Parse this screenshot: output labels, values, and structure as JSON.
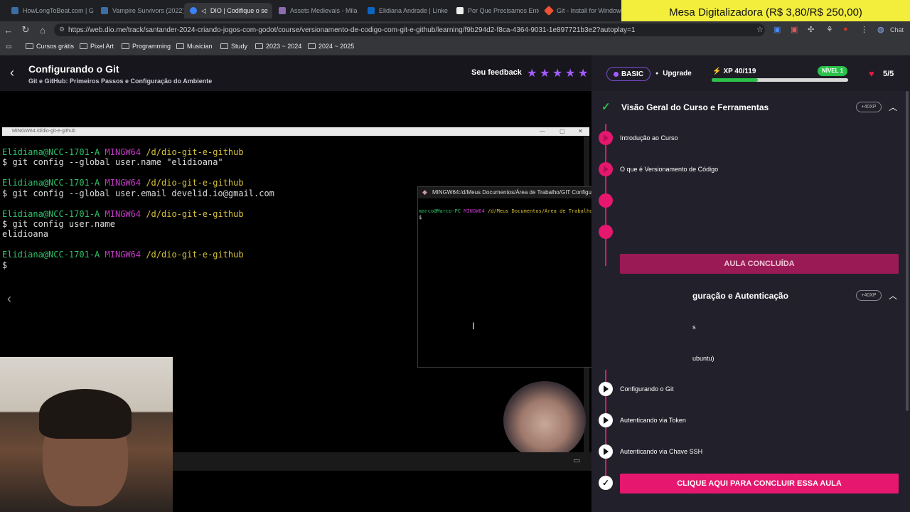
{
  "browser": {
    "tabs": [
      {
        "title": "HowLongToBeat.com | G",
        "favicon_color": "#3a6ea5"
      },
      {
        "title": "Vampire Survivors (2022)",
        "favicon_color": "#3a6ea5"
      },
      {
        "title": "DIO | Codifique o se",
        "favicon_color": "#3b82f6"
      },
      {
        "title": "Assets Medievais - Mila",
        "favicon_color": "#8c6bb1"
      },
      {
        "title": "Elidiana Andrade | Linke",
        "favicon_color": "#0a66c2"
      },
      {
        "title": "Por Que Precisamos Ente",
        "favicon_color": "#eeeeee"
      },
      {
        "title": "Git - Install for Windows",
        "favicon_color": "#f05133"
      }
    ],
    "url": "https://web.dio.me/track/santander-2024-criando-jogos-com-godot/course/versionamento-de-codigo-com-git-e-github/learning/f9b294d2-f8ca-4364-9031-1e897721b3e2?autoplay=1",
    "chat_label": "Chat",
    "bookmarks": [
      "Cursos grátis",
      "Pixel Art",
      "Programming",
      "Musician",
      "Study",
      "2023 ~ 2024",
      "2024 ~ 2025"
    ]
  },
  "promo": "Mesa Digitalizadora (R$ 3,80/R$ 250,00)",
  "lesson": {
    "title": "Configurando o Git",
    "subtitle": "Git e GitHub: Primeiros Passos e Configuração do Ambiente",
    "feedback_label": "Seu feedback",
    "stars": 5
  },
  "terminal1": {
    "title": "MINGW64:/d/dio-git-e-github",
    "user": "Elidiana@NCC-1701-A",
    "env": "MINGW64",
    "path": "/d/dio-git-e-github",
    "cmd1": "$ git config --global user.name \"elidioana\"",
    "cmd2": "$ git config --global user.email develid.io@gmail.com",
    "cmd3": "$ git config user.name",
    "out3": "elidioana",
    "prompt": "$"
  },
  "terminal2": {
    "title": "MINGW64:/d/Meus Documentos/Área de Trabalho/GIT Configurar",
    "user": "marco@Marco-PC",
    "env": "MINGW64",
    "path": "/d/Meus Documentos/Área de Trabalho/GIT Configurar",
    "prompt": "$"
  },
  "panel": {
    "plan": "BASIC",
    "upgrade": "Upgrade",
    "xp_label": "XP 40/119",
    "xp_fraction": 0.336,
    "level": "NÍVEL 1",
    "lives": "5/5",
    "section1": {
      "title": "Visão Geral do Curso e Ferramentas",
      "xp": "+40XP",
      "lessons": [
        "Introdução ao Curso",
        "O que é Versionamento de Código"
      ],
      "button": "AULA CONCLUÍDA"
    },
    "section2": {
      "title_visible": "guração e Autenticação",
      "xp": "+40XP",
      "partial_items": [
        "s",
        "ubuntu)"
      ],
      "lessons": [
        "Configurando o Git",
        "Autenticando via Token",
        "Autenticando via Chave SSH"
      ],
      "button": "CLIQUE AQUI PARA CONCLUIR ESSA AULA"
    }
  },
  "colors": {
    "accent_pink": "#e5176e",
    "accent_purple": "#a35cff",
    "green": "#2bc14a",
    "promo_yellow": "#f2ee3b"
  }
}
